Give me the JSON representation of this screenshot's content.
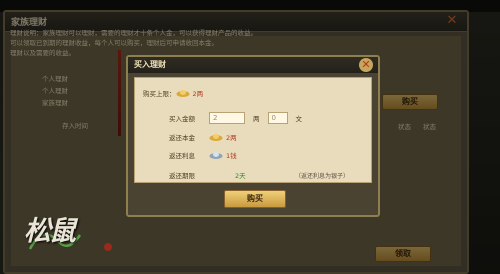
{
  "outer": {
    "title": "家族理财",
    "rules_label": "理财说明：",
    "rules_line1": "家族理财可以理财，需要的理财才十条个人金，可以获得理财产品的收益。",
    "rules_line2": "可以领取已到期的理财收益，每个人可以购买，理财后可申请收回本金。",
    "rules_line3": "理财以及需要的收益。",
    "rows": [
      "个人理财",
      "个人理财",
      "家族理财"
    ],
    "buy_button": "购买",
    "claim_button": "领取",
    "footer_left": "存入时间",
    "status_a": "状态",
    "status_b": "状态"
  },
  "dialog": {
    "title": "买入理财",
    "limit_label": "购买上限：",
    "limit_value": "2两",
    "amount_label": "买入金额",
    "amount_liang_value": "2",
    "liang_unit": "两",
    "amount_wen_value": "0",
    "wen_unit": "文",
    "principal_label": "返还本金",
    "principal_value": "2两",
    "interest_label": "返还利息",
    "interest_value": "1钱",
    "period_label": "返还期限",
    "period_value": "2天",
    "period_hint": "（返还利息为银子）",
    "buy_button": "购买"
  },
  "logo": {
    "text": "松鼠"
  },
  "colors": {
    "gold": "#e0bd6b",
    "panel": "#e9dcbc",
    "green": "#2a8a2a",
    "red": "#b03a1c"
  }
}
